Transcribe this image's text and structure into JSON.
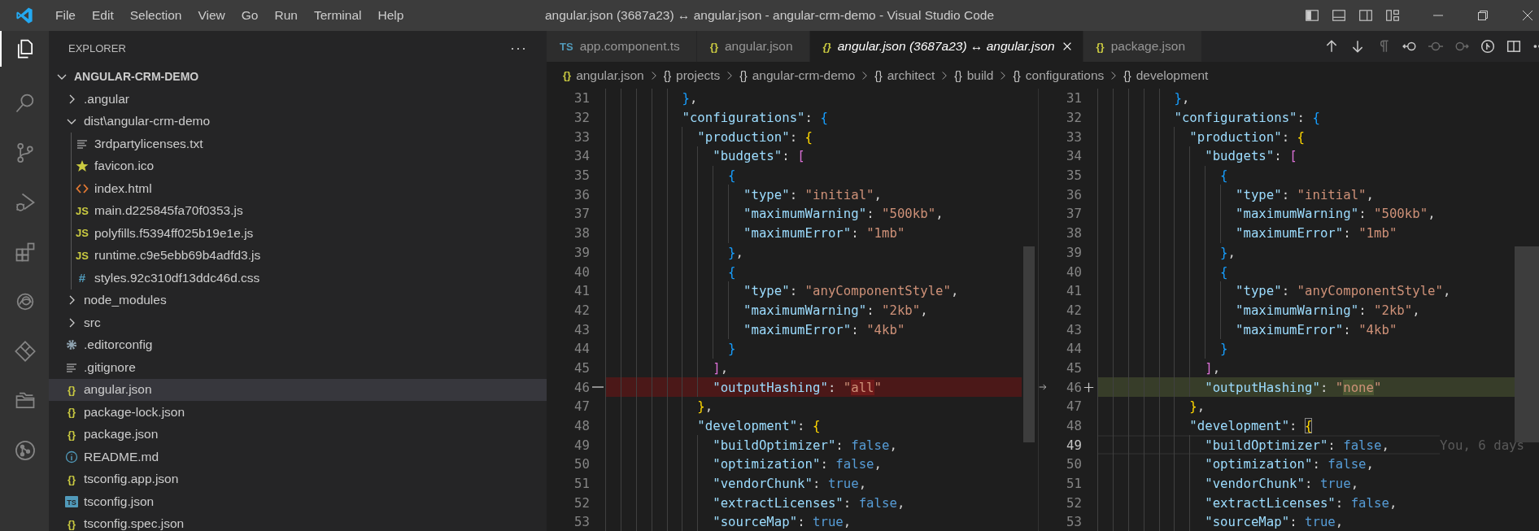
{
  "title_bar": {
    "menu": [
      "File",
      "Edit",
      "Selection",
      "View",
      "Go",
      "Run",
      "Terminal",
      "Help"
    ],
    "title": "angular.json (3687a23) ↔ angular.json - angular-crm-demo - Visual Studio Code"
  },
  "activity_bar": [
    {
      "kind": "explorer",
      "selected": true
    },
    {
      "kind": "search",
      "selected": false
    },
    {
      "kind": "source-control",
      "selected": false
    },
    {
      "kind": "run-debug",
      "selected": false
    },
    {
      "kind": "extensions",
      "selected": false
    },
    {
      "kind": "swirl",
      "selected": false
    },
    {
      "kind": "diamond",
      "selected": false
    },
    {
      "kind": "folders",
      "selected": false
    },
    {
      "kind": "git-graph",
      "selected": false
    }
  ],
  "sidebar": {
    "title": "EXPLORER",
    "more": "···",
    "project": {
      "name": "ANGULAR-CRM-DEMO",
      "expanded": true
    },
    "items": [
      {
        "label": ".angular",
        "kind": "folder",
        "expanded": false,
        "selected": false
      },
      {
        "label": "dist\\angular-crm-demo",
        "kind": "folder",
        "expanded": true,
        "selected": false,
        "children": [
          {
            "label": "3rdpartylicenses.txt",
            "kind": "text",
            "selected": false
          },
          {
            "label": "favicon.ico",
            "kind": "star",
            "selected": false
          },
          {
            "label": "index.html",
            "kind": "html",
            "selected": false
          },
          {
            "label": "main.d225845fa70f0353.js",
            "kind": "js",
            "glyph": "JS",
            "selected": false
          },
          {
            "label": "polyfills.f5394ff025b19e1e.js",
            "kind": "js",
            "glyph": "JS",
            "selected": false
          },
          {
            "label": "runtime.c9e5ebb69b4adfd3.js",
            "kind": "js",
            "glyph": "JS",
            "selected": false
          },
          {
            "label": "styles.92c310df13ddc46d.css",
            "kind": "css",
            "glyph": "#",
            "selected": false
          }
        ]
      },
      {
        "label": "node_modules",
        "kind": "folder",
        "expanded": false,
        "selected": false
      },
      {
        "label": "src",
        "kind": "folder",
        "expanded": false,
        "selected": false
      },
      {
        "label": ".editorconfig",
        "kind": "gear",
        "selected": false
      },
      {
        "label": ".gitignore",
        "kind": "text",
        "selected": false
      },
      {
        "label": "angular.json",
        "kind": "json",
        "glyph": "{}",
        "selected": true
      },
      {
        "label": "package-lock.json",
        "kind": "json",
        "glyph": "{}",
        "selected": false
      },
      {
        "label": "package.json",
        "kind": "json",
        "glyph": "{}",
        "selected": false
      },
      {
        "label": "README.md",
        "kind": "info",
        "selected": false
      },
      {
        "label": "tsconfig.app.json",
        "kind": "json",
        "glyph": "{}",
        "selected": false
      },
      {
        "label": "tsconfig.json",
        "kind": "ts",
        "glyph": "TS",
        "selected": false
      },
      {
        "label": "tsconfig.spec.json",
        "kind": "json",
        "glyph": "{}",
        "selected": false
      }
    ]
  },
  "tabs": [
    {
      "glyph": "TS",
      "kind": "ts",
      "label": "app.component.ts",
      "selected": false,
      "preview": false
    },
    {
      "glyph": "{}",
      "kind": "json",
      "label": "angular.json",
      "selected": false,
      "preview": false
    },
    {
      "glyph": "{}",
      "kind": "json",
      "label": "angular.json (3687a23) ↔ angular.json",
      "selected": true,
      "preview": true
    },
    {
      "glyph": "{}",
      "kind": "json",
      "label": "package.json",
      "selected": false,
      "preview": false
    }
  ],
  "editor_toolbar": [
    {
      "kind": "arrow-up",
      "disabled": false
    },
    {
      "kind": "arrow-down",
      "disabled": false
    },
    {
      "kind": "pilcrow",
      "disabled": true
    },
    {
      "kind": "circle-left",
      "disabled": false
    },
    {
      "kind": "circle-line",
      "disabled": true
    },
    {
      "kind": "circle-right",
      "disabled": true
    },
    {
      "kind": "branch-circle",
      "disabled": false
    },
    {
      "kind": "split",
      "disabled": false
    },
    {
      "kind": "more",
      "disabled": false
    }
  ],
  "breadcrumbs": [
    {
      "glyph": "{}",
      "kind": "file",
      "label": "angular.json"
    },
    {
      "glyph": "{}",
      "kind": "object",
      "label": "projects"
    },
    {
      "glyph": "{}",
      "kind": "object",
      "label": "angular-crm-demo"
    },
    {
      "glyph": "{}",
      "kind": "object",
      "label": "architect"
    },
    {
      "glyph": "{}",
      "kind": "object",
      "label": "build"
    },
    {
      "glyph": "{}",
      "kind": "object",
      "label": "configurations"
    },
    {
      "glyph": "{}",
      "kind": "object",
      "label": "development"
    }
  ],
  "diff_panes": [
    {
      "lines": [
        {
          "num": "31",
          "tokens": [
            {
              "text": "          }",
              "kind": "b3"
            },
            {
              "text": ",",
              "kind": "punct"
            }
          ]
        },
        {
          "num": "32",
          "tokens": [
            {
              "text": "          \"configurations\"",
              "kind": "key"
            },
            {
              "text": ": ",
              "kind": "punct"
            },
            {
              "text": "{",
              "kind": "b3"
            }
          ]
        },
        {
          "num": "33",
          "tokens": [
            {
              "text": "            \"production\"",
              "kind": "key"
            },
            {
              "text": ": ",
              "kind": "punct"
            },
            {
              "text": "{",
              "kind": "b1"
            }
          ]
        },
        {
          "num": "34",
          "tokens": [
            {
              "text": "              \"budgets\"",
              "kind": "key"
            },
            {
              "text": ": ",
              "kind": "punct"
            },
            {
              "text": "[",
              "kind": "b2"
            }
          ]
        },
        {
          "num": "35",
          "tokens": [
            {
              "text": "                {",
              "kind": "b3"
            }
          ]
        },
        {
          "num": "36",
          "tokens": [
            {
              "text": "                  \"type\"",
              "kind": "key"
            },
            {
              "text": ": ",
              "kind": "punct"
            },
            {
              "text": "\"initial\"",
              "kind": "string"
            },
            {
              "text": ",",
              "kind": "punct"
            }
          ]
        },
        {
          "num": "37",
          "tokens": [
            {
              "text": "                  \"maximumWarning\"",
              "kind": "key"
            },
            {
              "text": ": ",
              "kind": "punct"
            },
            {
              "text": "\"500kb\"",
              "kind": "string"
            },
            {
              "text": ",",
              "kind": "punct"
            }
          ]
        },
        {
          "num": "38",
          "tokens": [
            {
              "text": "                  \"maximumError\"",
              "kind": "key"
            },
            {
              "text": ": ",
              "kind": "punct"
            },
            {
              "text": "\"1mb\"",
              "kind": "string"
            }
          ]
        },
        {
          "num": "39",
          "tokens": [
            {
              "text": "                }",
              "kind": "b3"
            },
            {
              "text": ",",
              "kind": "punct"
            }
          ]
        },
        {
          "num": "40",
          "tokens": [
            {
              "text": "                {",
              "kind": "b3"
            }
          ]
        },
        {
          "num": "41",
          "tokens": [
            {
              "text": "                  \"type\"",
              "kind": "key"
            },
            {
              "text": ": ",
              "kind": "punct"
            },
            {
              "text": "\"anyComponentStyle\"",
              "kind": "string"
            },
            {
              "text": ",",
              "kind": "punct"
            }
          ]
        },
        {
          "num": "42",
          "tokens": [
            {
              "text": "                  \"maximumWarning\"",
              "kind": "key"
            },
            {
              "text": ": ",
              "kind": "punct"
            },
            {
              "text": "\"2kb\"",
              "kind": "string"
            },
            {
              "text": ",",
              "kind": "punct"
            }
          ]
        },
        {
          "num": "43",
          "tokens": [
            {
              "text": "                  \"maximumError\"",
              "kind": "key"
            },
            {
              "text": ": ",
              "kind": "punct"
            },
            {
              "text": "\"4kb\"",
              "kind": "string"
            }
          ]
        },
        {
          "num": "44",
          "tokens": [
            {
              "text": "                }",
              "kind": "b3"
            }
          ]
        },
        {
          "num": "45",
          "tokens": [
            {
              "text": "              ]",
              "kind": "b2"
            },
            {
              "text": ",",
              "kind": "punct"
            }
          ]
        },
        {
          "num": "46",
          "kind": "removed",
          "tokens": [
            {
              "text": "              \"outputHashing\"",
              "kind": "key"
            },
            {
              "text": ": ",
              "kind": "punct"
            },
            {
              "text": "\"",
              "kind": "string"
            },
            {
              "text": "all",
              "kind": "string",
              "changed": true
            },
            {
              "text": "\"",
              "kind": "string"
            }
          ]
        },
        {
          "num": "47",
          "tokens": [
            {
              "text": "            }",
              "kind": "b1"
            },
            {
              "text": ",",
              "kind": "punct"
            }
          ]
        },
        {
          "num": "48",
          "tokens": [
            {
              "text": "            \"development\"",
              "kind": "key"
            },
            {
              "text": ": ",
              "kind": "punct"
            },
            {
              "text": "{",
              "kind": "b1"
            }
          ]
        },
        {
          "num": "49",
          "tokens": [
            {
              "text": "              \"buildOptimizer\"",
              "kind": "key"
            },
            {
              "text": ": ",
              "kind": "punct"
            },
            {
              "text": "false",
              "kind": "literal"
            },
            {
              "text": ",",
              "kind": "punct"
            }
          ]
        },
        {
          "num": "50",
          "tokens": [
            {
              "text": "              \"optimization\"",
              "kind": "key"
            },
            {
              "text": ": ",
              "kind": "punct"
            },
            {
              "text": "false",
              "kind": "literal"
            },
            {
              "text": ",",
              "kind": "punct"
            }
          ]
        },
        {
          "num": "51",
          "tokens": [
            {
              "text": "              \"vendorChunk\"",
              "kind": "key"
            },
            {
              "text": ": ",
              "kind": "punct"
            },
            {
              "text": "true",
              "kind": "literal"
            },
            {
              "text": ",",
              "kind": "punct"
            }
          ]
        },
        {
          "num": "52",
          "tokens": [
            {
              "text": "              \"extractLicenses\"",
              "kind": "key"
            },
            {
              "text": ": ",
              "kind": "punct"
            },
            {
              "text": "false",
              "kind": "literal"
            },
            {
              "text": ",",
              "kind": "punct"
            }
          ]
        },
        {
          "num": "53",
          "tokens": [
            {
              "text": "              \"sourceMap\"",
              "kind": "key"
            },
            {
              "text": ": ",
              "kind": "punct"
            },
            {
              "text": "true",
              "kind": "literal"
            },
            {
              "text": ",",
              "kind": "punct"
            }
          ]
        }
      ]
    },
    {
      "lines": [
        {
          "num": "31",
          "tokens": [
            {
              "text": "          }",
              "kind": "b3"
            },
            {
              "text": ",",
              "kind": "punct"
            }
          ]
        },
        {
          "num": "32",
          "tokens": [
            {
              "text": "          \"configurations\"",
              "kind": "key"
            },
            {
              "text": ": ",
              "kind": "punct"
            },
            {
              "text": "{",
              "kind": "b3"
            }
          ]
        },
        {
          "num": "33",
          "tokens": [
            {
              "text": "            \"production\"",
              "kind": "key"
            },
            {
              "text": ": ",
              "kind": "punct"
            },
            {
              "text": "{",
              "kind": "b1"
            }
          ]
        },
        {
          "num": "34",
          "tokens": [
            {
              "text": "              \"budgets\"",
              "kind": "key"
            },
            {
              "text": ": ",
              "kind": "punct"
            },
            {
              "text": "[",
              "kind": "b2"
            }
          ]
        },
        {
          "num": "35",
          "tokens": [
            {
              "text": "                {",
              "kind": "b3"
            }
          ]
        },
        {
          "num": "36",
          "tokens": [
            {
              "text": "                  \"type\"",
              "kind": "key"
            },
            {
              "text": ": ",
              "kind": "punct"
            },
            {
              "text": "\"initial\"",
              "kind": "string"
            },
            {
              "text": ",",
              "kind": "punct"
            }
          ]
        },
        {
          "num": "37",
          "tokens": [
            {
              "text": "                  \"maximumWarning\"",
              "kind": "key"
            },
            {
              "text": ": ",
              "kind": "punct"
            },
            {
              "text": "\"500kb\"",
              "kind": "string"
            },
            {
              "text": ",",
              "kind": "punct"
            }
          ]
        },
        {
          "num": "38",
          "tokens": [
            {
              "text": "                  \"maximumError\"",
              "kind": "key"
            },
            {
              "text": ": ",
              "kind": "punct"
            },
            {
              "text": "\"1mb\"",
              "kind": "string"
            }
          ]
        },
        {
          "num": "39",
          "tokens": [
            {
              "text": "                }",
              "kind": "b3"
            },
            {
              "text": ",",
              "kind": "punct"
            }
          ]
        },
        {
          "num": "40",
          "tokens": [
            {
              "text": "                {",
              "kind": "b3"
            }
          ]
        },
        {
          "num": "41",
          "tokens": [
            {
              "text": "                  \"type\"",
              "kind": "key"
            },
            {
              "text": ": ",
              "kind": "punct"
            },
            {
              "text": "\"anyComponentStyle\"",
              "kind": "string"
            },
            {
              "text": ",",
              "kind": "punct"
            }
          ]
        },
        {
          "num": "42",
          "tokens": [
            {
              "text": "                  \"maximumWarning\"",
              "kind": "key"
            },
            {
              "text": ": ",
              "kind": "punct"
            },
            {
              "text": "\"2kb\"",
              "kind": "string"
            },
            {
              "text": ",",
              "kind": "punct"
            }
          ]
        },
        {
          "num": "43",
          "tokens": [
            {
              "text": "                  \"maximumError\"",
              "kind": "key"
            },
            {
              "text": ": ",
              "kind": "punct"
            },
            {
              "text": "\"4kb\"",
              "kind": "string"
            }
          ]
        },
        {
          "num": "44",
          "tokens": [
            {
              "text": "                }",
              "kind": "b3"
            }
          ]
        },
        {
          "num": "45",
          "tokens": [
            {
              "text": "              ]",
              "kind": "b2"
            },
            {
              "text": ",",
              "kind": "punct"
            }
          ]
        },
        {
          "num": "46",
          "kind": "added",
          "tokens": [
            {
              "text": "              \"outputHashing\"",
              "kind": "key"
            },
            {
              "text": ": ",
              "kind": "punct"
            },
            {
              "text": "\"",
              "kind": "string"
            },
            {
              "text": "none",
              "kind": "string",
              "changed": true
            },
            {
              "text": "\"",
              "kind": "string"
            }
          ]
        },
        {
          "num": "47",
          "tokens": [
            {
              "text": "            }",
              "kind": "b1"
            },
            {
              "text": ",",
              "kind": "punct"
            }
          ]
        },
        {
          "num": "48",
          "tokens": [
            {
              "text": "            \"development\"",
              "kind": "key"
            },
            {
              "text": ": ",
              "kind": "punct"
            },
            {
              "text": "{",
              "kind": "b1",
              "matched": true
            }
          ]
        },
        {
          "num": "49",
          "current": true,
          "blame": "You, 6 days",
          "tokens": [
            {
              "text": "              \"buildOptimizer\"",
              "kind": "key"
            },
            {
              "text": ": ",
              "kind": "punct"
            },
            {
              "text": "false",
              "kind": "literal"
            },
            {
              "text": ",",
              "kind": "punct"
            }
          ]
        },
        {
          "num": "50",
          "tokens": [
            {
              "text": "              \"optimization\"",
              "kind": "key"
            },
            {
              "text": ": ",
              "kind": "punct"
            },
            {
              "text": "false",
              "kind": "literal"
            },
            {
              "text": ",",
              "kind": "punct"
            }
          ]
        },
        {
          "num": "51",
          "tokens": [
            {
              "text": "              \"vendorChunk\"",
              "kind": "key"
            },
            {
              "text": ": ",
              "kind": "punct"
            },
            {
              "text": "true",
              "kind": "literal"
            },
            {
              "text": ",",
              "kind": "punct"
            }
          ]
        },
        {
          "num": "52",
          "tokens": [
            {
              "text": "              \"extractLicenses\"",
              "kind": "key"
            },
            {
              "text": ": ",
              "kind": "punct"
            },
            {
              "text": "false",
              "kind": "literal"
            },
            {
              "text": ",",
              "kind": "punct"
            }
          ]
        },
        {
          "num": "53",
          "tokens": [
            {
              "text": "              \"sourceMap\"",
              "kind": "key"
            },
            {
              "text": ": ",
              "kind": "punct"
            },
            {
              "text": "true",
              "kind": "literal"
            },
            {
              "text": ",",
              "kind": "punct"
            }
          ]
        }
      ]
    }
  ]
}
